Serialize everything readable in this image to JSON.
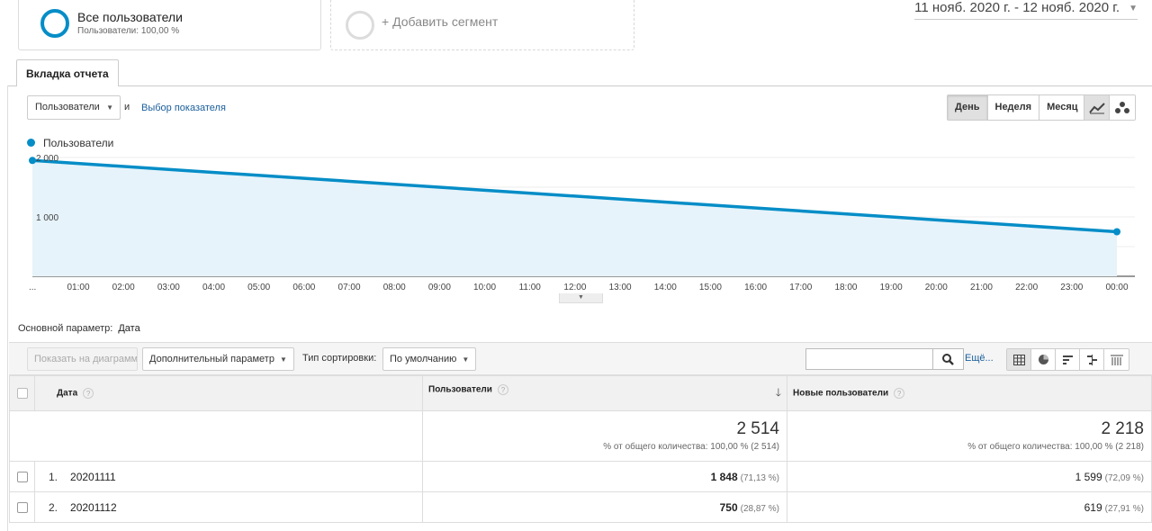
{
  "segments": {
    "active": {
      "title": "Все пользователи",
      "subtitle": "Пользователи: 100,00 %"
    },
    "add_label": "+ Добавить сегмент"
  },
  "date_range": "11 нояб. 2020 г. - 12 нояб. 2020 г.",
  "report_tab": "Вкладка отчета",
  "metric": {
    "selected": "Пользователи",
    "and_label": "и",
    "choose_link": "Выбор показателя"
  },
  "period_buttons": [
    {
      "label": "День",
      "active": true
    },
    {
      "label": "Неделя",
      "active": false
    },
    {
      "label": "Месяц",
      "active": false
    }
  ],
  "chart_type_icons": [
    "line-chart-icon",
    "motion-chart-icon"
  ],
  "chart_data": {
    "type": "area",
    "series": [
      {
        "name": "Пользователи",
        "color": "#058dc7",
        "start": 1950,
        "end": 750
      }
    ],
    "y_ticks": [
      {
        "label": "2 000",
        "value": 2000
      },
      {
        "label": "1 000",
        "value": 1000
      }
    ],
    "ylim": [
      0,
      2000
    ],
    "x_first_label": "...",
    "x_ticks": [
      "01:00",
      "02:00",
      "03:00",
      "04:00",
      "05:00",
      "06:00",
      "07:00",
      "08:00",
      "09:00",
      "10:00",
      "11:00",
      "12:00",
      "13:00",
      "14:00",
      "15:00",
      "16:00",
      "17:00",
      "18:00",
      "19:00",
      "20:00",
      "21:00",
      "22:00",
      "23:00",
      "00:00"
    ]
  },
  "primary_dimension": {
    "label": "Основной параметр:",
    "value": "Дата"
  },
  "toolbar": {
    "plot_rows": "Показать на диаграмме",
    "secondary_dim": "Дополнительный параметр",
    "sort_label": "Тип сортировки:",
    "sort_value": "По умолчанию",
    "more": "Ещё..."
  },
  "view_icons": [
    "table-view-icon",
    "pie-view-icon",
    "performance-view-icon",
    "comparison-view-icon",
    "pivot-view-icon"
  ],
  "table": {
    "columns": {
      "date": "Дата",
      "users": "Пользователи",
      "new_users": "Новые пользователи"
    },
    "help_mark": "?",
    "totals": {
      "users": "2 514",
      "users_pct": "% от общего количества: 100,00 % (2 514)",
      "new_users": "2 218",
      "new_users_pct": "% от общего количества: 100,00 % (2 218)"
    },
    "rows": [
      {
        "index": "1.",
        "date": "20201111",
        "users": "1 848",
        "users_pct": "(71,13 %)",
        "new_users": "1 599",
        "new_users_pct": "(72,09 %)"
      },
      {
        "index": "2.",
        "date": "20201112",
        "users": "750",
        "users_pct": "(28,87 %)",
        "new_users": "619",
        "new_users_pct": "(27,91 %)"
      }
    ]
  }
}
